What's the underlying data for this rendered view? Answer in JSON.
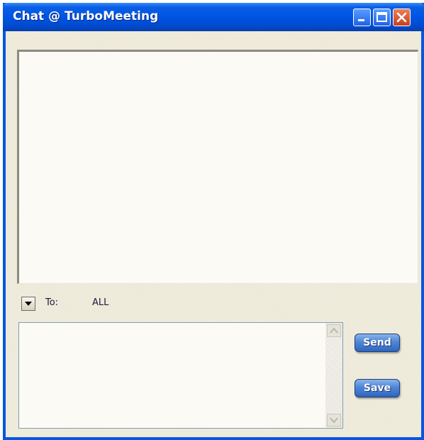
{
  "window": {
    "title": "Chat @ TurboMeeting"
  },
  "titlebar_buttons": {
    "minimize_icon": "minimize-icon",
    "maximize_icon": "maximize-icon",
    "close_icon": "close-icon"
  },
  "chat_log": {
    "messages": []
  },
  "recipient": {
    "label": "To:",
    "value": "ALL",
    "dropdown_icon": "chevron-down-icon"
  },
  "message_input": {
    "value": "",
    "placeholder": ""
  },
  "actions": {
    "send_label": "Send",
    "save_label": "Save"
  },
  "colors": {
    "titlebar": "#0054e3",
    "window_bg": "#ece9d8",
    "button_blue": "#4f86d6",
    "close_red": "#c8401c"
  }
}
